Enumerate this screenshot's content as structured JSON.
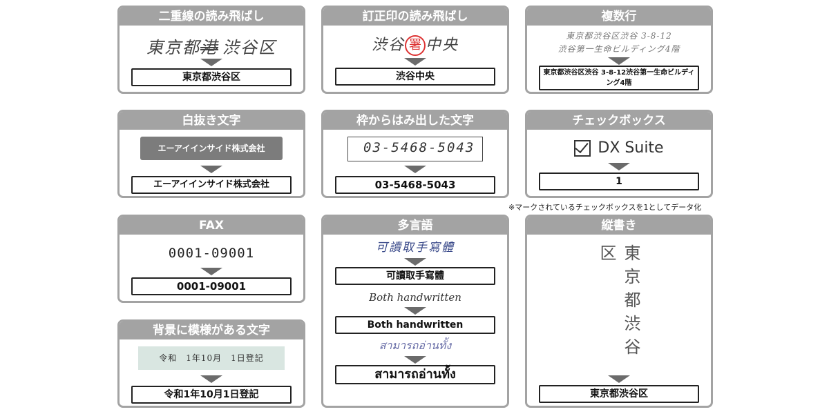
{
  "cards": {
    "double_line": {
      "title": "二重線の読み飛ばし",
      "input": "東京都港渋谷区",
      "struck": "港",
      "input_before": "東京都",
      "input_after": "渋谷区",
      "output": "東京都渋谷区"
    },
    "stamp": {
      "title": "訂正印の読み飛ばし",
      "input_before": "渋谷",
      "stamp_char": "署",
      "input_after": "中央",
      "output": "渋谷中央"
    },
    "multiline": {
      "title": "複数行",
      "input_line1": "東京都渋谷区渋谷 3-8-12",
      "input_line2": "渋谷第一生命ビルディング4階",
      "output": "東京都渋谷区渋谷 3-8-12渋谷第一生命ビルディング4階"
    },
    "reverse": {
      "title": "白抜き文字",
      "input": "エーアイインサイド株式会社",
      "output": "エーアイインサイド株式会社"
    },
    "overflow": {
      "title": "枠からはみ出した文字",
      "input": "03-5468-5043",
      "output": "03-5468-5043"
    },
    "checkbox": {
      "title": "チェックボックス",
      "input": "DX Suite",
      "checked": true,
      "output": "1",
      "note": "※マークされているチェックボックスを1としてデータ化"
    },
    "fax": {
      "title": "FAX",
      "input": "0001-09001",
      "output": "0001-09001"
    },
    "pattern": {
      "title": "背景に模様がある文字",
      "input": "令和　1年10月　1日登記",
      "output": "令和1年10月1日登記"
    },
    "multilang": {
      "title": "多言語",
      "items": [
        {
          "input": "可讀取手寫體",
          "output": "可讀取手寫體"
        },
        {
          "input": "Both handwritten",
          "output": "Both handwritten"
        },
        {
          "input": "สามารถอ่านทั้ง",
          "output": "สามารถอ่านทั้ง"
        }
      ]
    },
    "vertical": {
      "title": "縦書き",
      "input": "東京都渋谷区",
      "output": "東京都渋谷区"
    }
  },
  "colors": {
    "header_bg": "#a3a3a3",
    "arrow": "#6b6b6b",
    "stamp_red": "#dd3333",
    "pattern_bg": "#d9e6e1"
  }
}
